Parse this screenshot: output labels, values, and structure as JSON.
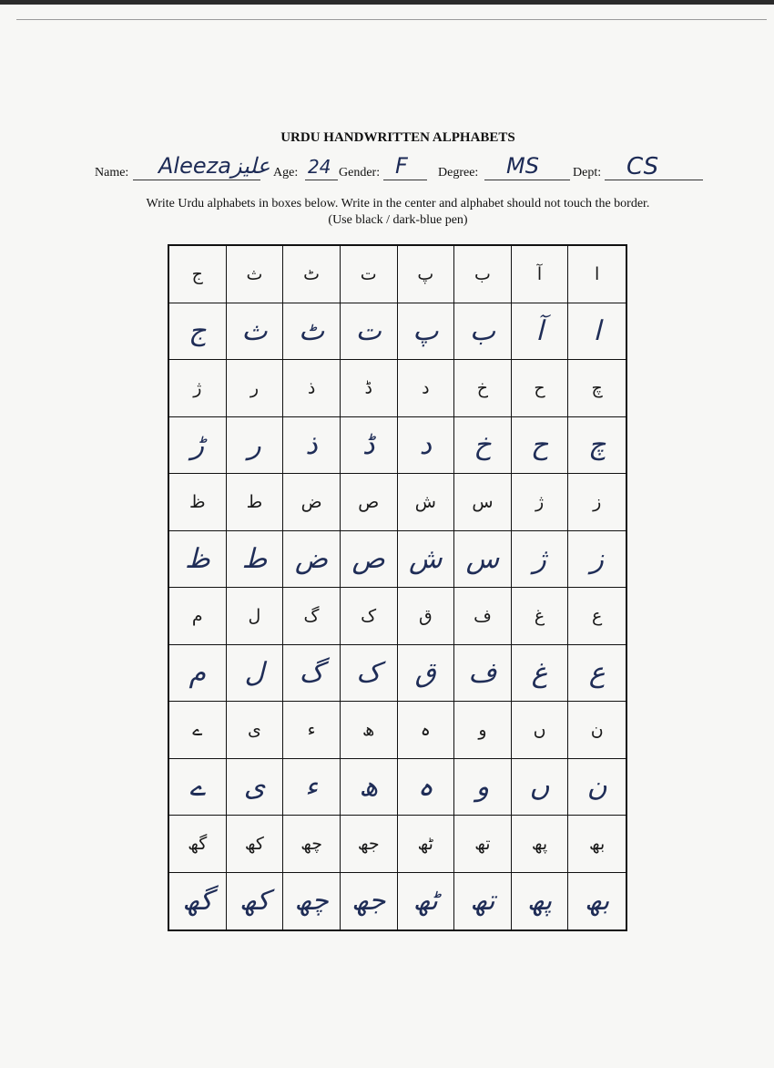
{
  "form": {
    "title": "URDU HANDWRITTEN ALPHABETS",
    "name_label": "Name:",
    "name_value": "Aleezaعلیز",
    "age_label": "Age:",
    "age_value": "24",
    "gender_label": "Gender:",
    "gender_value": "F",
    "degree_label": "Degree:",
    "degree_value": "MS",
    "dept_label": "Dept:",
    "dept_value": "CS",
    "instruction_line1": "Write Urdu alphabets in boxes below. Write in the center and alphabet should not touch the border.",
    "instruction_line2": "(Use black / dark-blue pen)"
  },
  "grid": {
    "rows": [
      {
        "kind": "printed",
        "cells": [
          "ج",
          "ث",
          "ٹ",
          "ت",
          "پ",
          "ب",
          "آ",
          "ا"
        ]
      },
      {
        "kind": "written",
        "cells": [
          "ج",
          "ث",
          "ٹ",
          "ت",
          "پ",
          "ب",
          "آ",
          "ا"
        ]
      },
      {
        "kind": "printed",
        "cells": [
          "ژ",
          "ر",
          "ذ",
          "ڈ",
          "د",
          "خ",
          "ح",
          "چ"
        ]
      },
      {
        "kind": "written",
        "cells": [
          "ڑ",
          "ر",
          "ذ",
          "ڈ",
          "د",
          "خ",
          "ح",
          "چ"
        ]
      },
      {
        "kind": "printed",
        "cells": [
          "ظ",
          "ط",
          "ض",
          "ص",
          "ش",
          "س",
          "ژ",
          "ز"
        ]
      },
      {
        "kind": "written",
        "cells": [
          "ظ",
          "ط",
          "ض",
          "ص",
          "ش",
          "س",
          "ژ",
          "ز"
        ]
      },
      {
        "kind": "printed",
        "cells": [
          "م",
          "ل",
          "گ",
          "ک",
          "ق",
          "ف",
          "غ",
          "ع"
        ]
      },
      {
        "kind": "written",
        "cells": [
          "م",
          "ل",
          "گ",
          "ک",
          "ق",
          "ف",
          "غ",
          "ع"
        ]
      },
      {
        "kind": "printed",
        "cells": [
          "ے",
          "ی",
          "ء",
          "ھ",
          "ہ",
          "و",
          "ں",
          "ن"
        ]
      },
      {
        "kind": "written",
        "cells": [
          "ے",
          "ی",
          "ء",
          "ھ",
          "ہ",
          "و",
          "ں",
          "ن"
        ]
      },
      {
        "kind": "printed",
        "cells": [
          "گھ",
          "کھ",
          "چھ",
          "جھ",
          "ٹھ",
          "تھ",
          "پھ",
          "بھ"
        ]
      },
      {
        "kind": "written",
        "cells": [
          "گھ",
          "کھ",
          "چھ",
          "جھ",
          "ٹھ",
          "تھ",
          "پھ",
          "بھ"
        ]
      }
    ]
  }
}
